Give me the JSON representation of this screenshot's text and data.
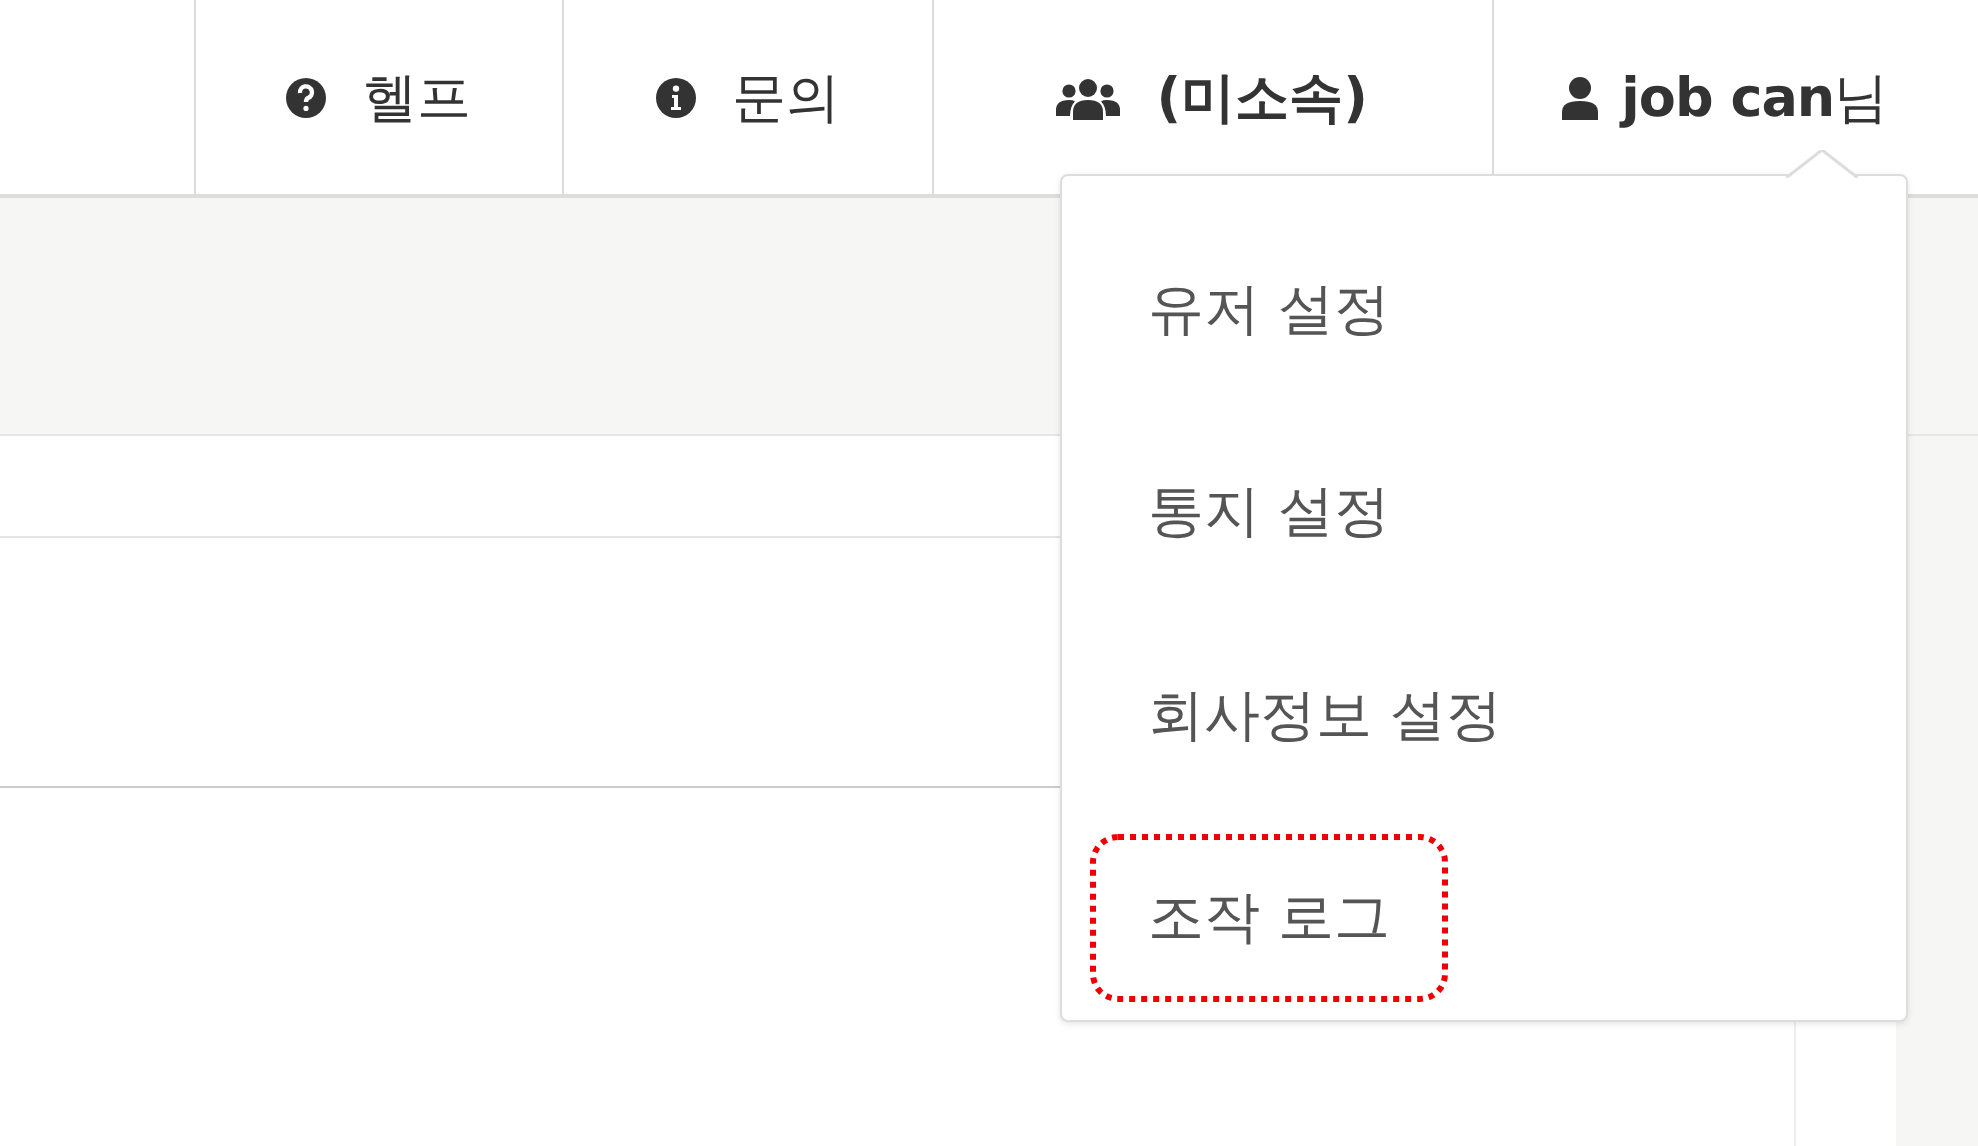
{
  "nav": [
    {
      "kind": "help",
      "label": "헬프"
    },
    {
      "kind": "info",
      "label": "문의"
    },
    {
      "kind": "group",
      "label": "(미소속)"
    },
    {
      "kind": "user",
      "label": "**job can**님"
    }
  ],
  "user_menu": {
    "expanded": true,
    "items": [
      {
        "label": "유저 설정",
        "highlighted": false
      },
      {
        "label": "통지 설정",
        "highlighted": false
      },
      {
        "label": "회사정보 설정",
        "highlighted": false
      },
      {
        "label": "조작 로그",
        "highlighted": true
      }
    ]
  }
}
